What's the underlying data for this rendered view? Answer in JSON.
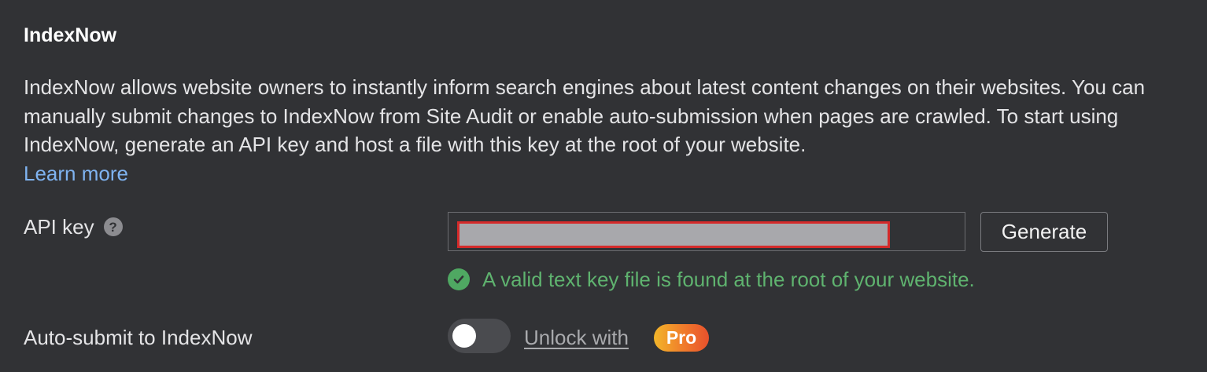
{
  "section": {
    "title": "IndexNow",
    "description": "IndexNow allows website owners to instantly inform search engines about latest content changes on their websites. You can manually submit changes to IndexNow from Site Audit or enable auto-submission when pages are crawled. To start using IndexNow, generate an API key and host a file with this key at the root of your website.",
    "learn_more": "Learn more"
  },
  "api_key": {
    "label": "API key",
    "help_icon": "question-circle-icon",
    "value": "",
    "generate_label": "Generate",
    "status_icon": "check-circle-icon",
    "status_text": "A valid text key file is found at the root of your website.",
    "status_color": "#5fb36f"
  },
  "auto_submit": {
    "label": "Auto-submit to IndexNow",
    "toggle_on": false,
    "unlock_text": "Unlock with",
    "badge": "Pro"
  },
  "colors": {
    "background": "#313235",
    "link": "#7fb3f0",
    "redaction_border": "#d42a2a"
  }
}
